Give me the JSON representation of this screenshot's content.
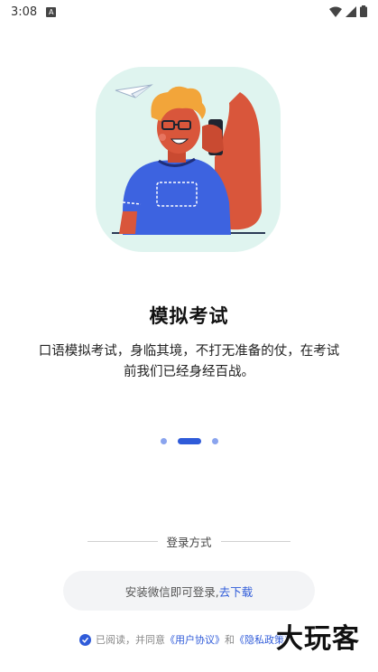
{
  "status_bar": {
    "time": "3:08",
    "notification_icon": "a-icon"
  },
  "onboarding": {
    "title": "模拟考试",
    "description": "口语模拟考试，身临其境，不打无准备的仗，在考试前我们已经身经百战。",
    "page_indicator": {
      "total": 3,
      "current": 2
    }
  },
  "login": {
    "divider_label": "登录方式",
    "wechat_prompt": "安装微信即可登录,",
    "wechat_link": "去下载"
  },
  "agreement": {
    "prefix": "已阅读，并同意",
    "user_agreement": "《用户协议》",
    "and": "和",
    "privacy_policy": "《隐私政策》"
  },
  "watermark": "大玩客",
  "colors": {
    "accent": "#2f5bd9",
    "illustration_bg": "#dff4ef"
  }
}
